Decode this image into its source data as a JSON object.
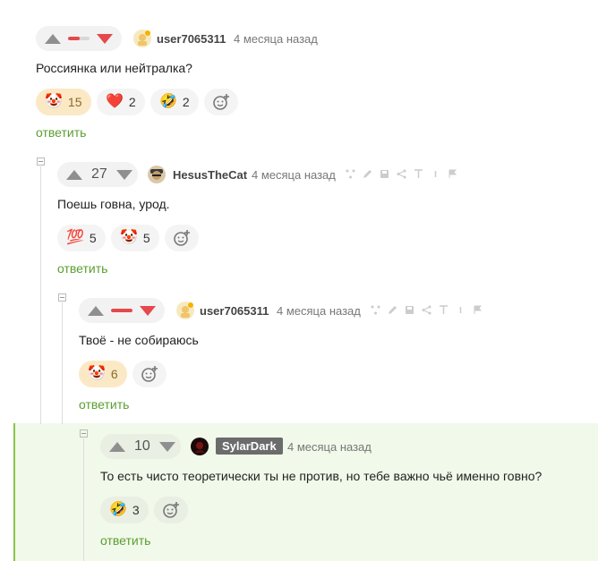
{
  "comments": [
    {
      "id": "c1",
      "vote_ratio": 0.55,
      "username": "user7065311",
      "time": "4 месяца назад",
      "text": "Россиянка или нейтралка?",
      "reactions": [
        {
          "emoji": "🤡",
          "count": "15",
          "active": true
        },
        {
          "emoji": "❤️",
          "count": "2",
          "active": false
        },
        {
          "emoji": "🤣",
          "count": "2",
          "active": false
        }
      ],
      "reply_label": "ответить"
    },
    {
      "id": "c2",
      "score": "27",
      "username": "HesusTheCat",
      "time": "4 месяца назад",
      "text": "Поешь говна, урод.",
      "reactions": [
        {
          "emoji": "💯",
          "count": "5",
          "active": false
        },
        {
          "emoji": "🤡",
          "count": "5",
          "active": false
        }
      ],
      "reply_label": "ответить"
    },
    {
      "id": "c3",
      "vote_ratio": 1.0,
      "username": "user7065311",
      "time": "4 месяца назад",
      "text": "Твоё - не собираюсь",
      "reactions": [
        {
          "emoji": "🤡",
          "count": "6",
          "active": true
        }
      ],
      "reply_label": "ответить"
    },
    {
      "id": "c4",
      "score": "10",
      "username": "SylarDark",
      "time": "4 месяца назад",
      "text": "То есть чисто теоретически ты не против, но тебе важно чьё именно говно?",
      "reactions": [
        {
          "emoji": "🤣",
          "count": "3",
          "active": false
        }
      ],
      "reply_label": "ответить"
    }
  ],
  "colors": {
    "accent_green": "#5a9e2f",
    "vote_red": "#e5484d",
    "highlight_bg": "#f1f9ea",
    "highlight_border": "#8bc34a",
    "reaction_active_bg": "#fbe9c6"
  },
  "icons": {
    "upvote": "triangle-up-icon",
    "downvote": "triangle-down-icon",
    "add_reaction": "add-reaction-icon",
    "tools": [
      "branch-icon",
      "edit-icon",
      "save-icon",
      "share-icon",
      "pin-icon",
      "more-icon",
      "flag-icon"
    ]
  }
}
